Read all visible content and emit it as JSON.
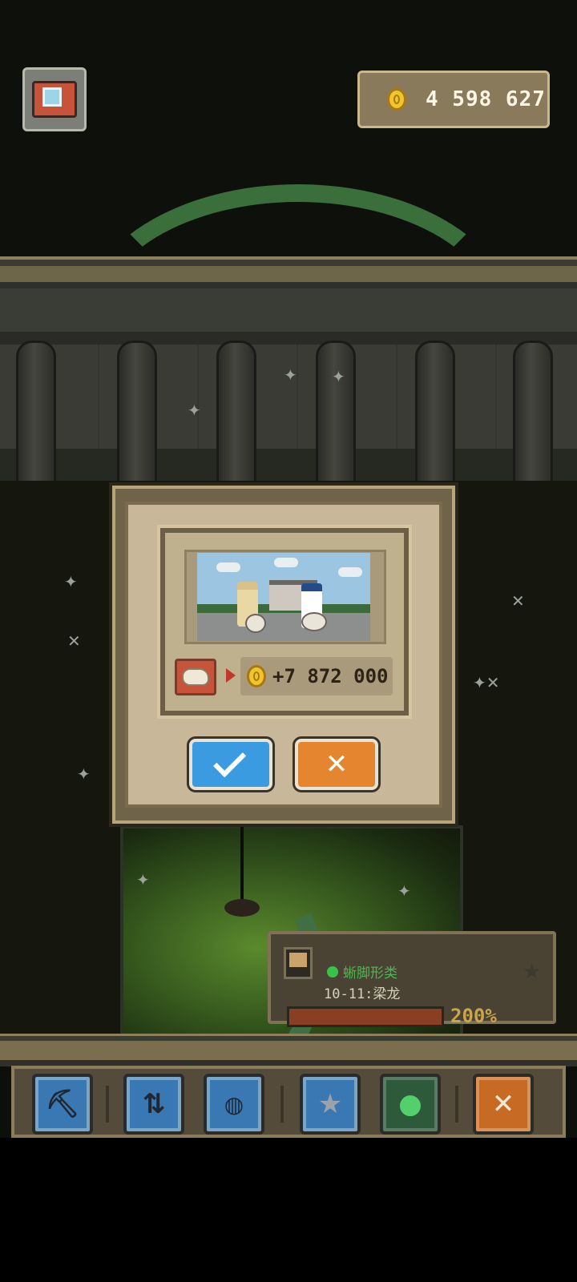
{
  "header": {
    "coins": "4 598 627"
  },
  "modal": {
    "reward": "+7 872 000"
  },
  "info_panel": {
    "category": "蜥脚形类",
    "specimen": "10-11:梁龙",
    "progress_label": "200%",
    "progress_fraction": 1.0
  },
  "colors": {
    "confirm": "#3a9be0",
    "cancel": "#e5852f",
    "coin": "#f2c52c",
    "category": "#48b94f"
  }
}
